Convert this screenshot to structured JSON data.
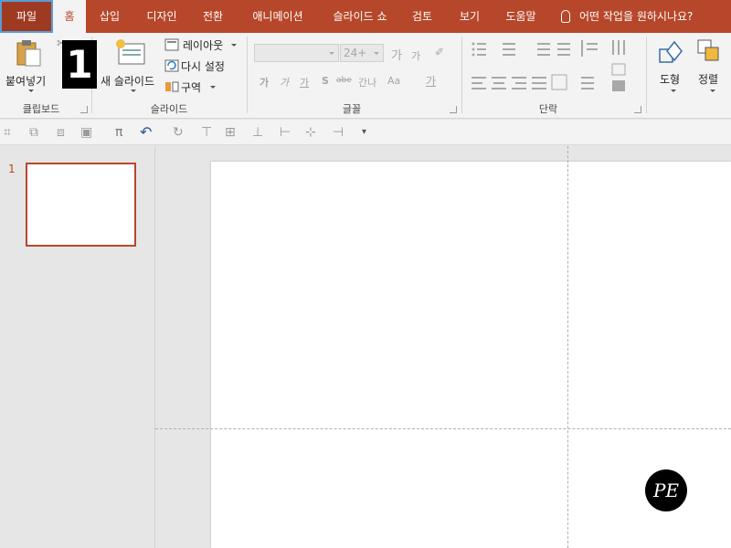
{
  "tabs": {
    "file": "파일",
    "home": "홈",
    "insert": "삽입",
    "design": "디자인",
    "transitions": "전환",
    "animations": "애니메이션",
    "slideshow": "슬라이드 쇼",
    "review": "검토",
    "view": "보기",
    "help": "도움말"
  },
  "tell_me": "어떤 작업을 원하시나요?",
  "ribbon": {
    "clipboard": {
      "paste": "붙여넣기",
      "group_label": "클립보드"
    },
    "slides": {
      "new_slide": "새 슬라이드",
      "layout": "레이아웃",
      "reset": "다시 설정",
      "section": "구역",
      "group_label": "슬라이드"
    },
    "font": {
      "font_name": "",
      "font_size": "24+",
      "grow": "가",
      "shrink": "가",
      "bold": "가",
      "italic": "가",
      "underline": "가",
      "shadow": "S",
      "strike": "abe",
      "spacing": "간나",
      "case": "Aa",
      "color": "가",
      "group_label": "글꼴"
    },
    "paragraph": {
      "group_label": "단락"
    },
    "drawing": {
      "shapes": "도형",
      "arrange": "정렬"
    }
  },
  "thumbnail": {
    "number": "1"
  },
  "overlay": {
    "badge": "1",
    "watermark": "PE"
  },
  "colors": {
    "accent": "#b7472a",
    "ribbon_bg": "#f3f3f3",
    "workspace": "#e6e6e6"
  }
}
